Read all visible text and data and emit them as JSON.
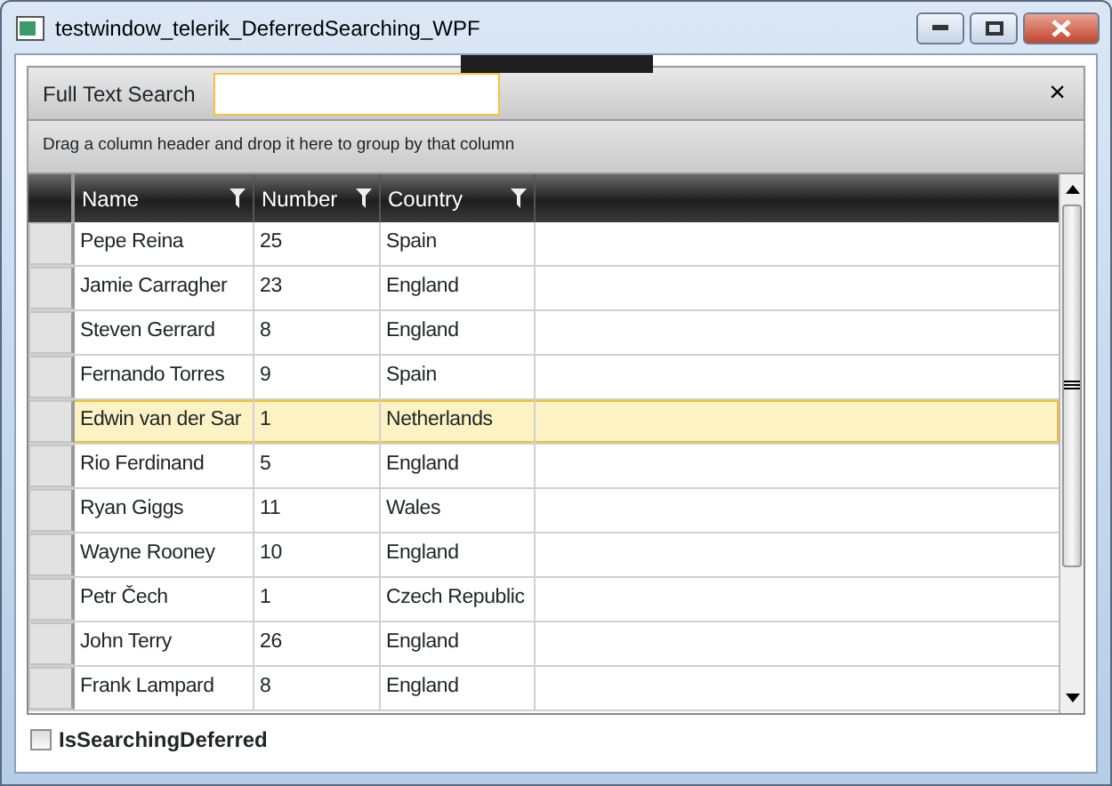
{
  "window": {
    "title": "testwindow_telerik_DeferredSearching_WPF"
  },
  "search": {
    "label": "Full Text Search",
    "clear": "×"
  },
  "group_panel": {
    "hint": "Drag a column header and drop it here to group by that column"
  },
  "table": {
    "columns": [
      "Name",
      "Number",
      "Country"
    ],
    "rows": [
      {
        "cells": [
          "Pepe Reina",
          "25",
          "Spain"
        ],
        "selected": false
      },
      {
        "cells": [
          "Jamie Carragher",
          "23",
          "England"
        ],
        "selected": false
      },
      {
        "cells": [
          "Steven Gerrard",
          "8",
          "England"
        ],
        "selected": false
      },
      {
        "cells": [
          "Fernando Torres",
          "9",
          "Spain"
        ],
        "selected": false
      },
      {
        "cells": [
          "Edwin van der Sar",
          "1",
          "Netherlands"
        ],
        "selected": true
      },
      {
        "cells": [
          "Rio Ferdinand",
          "5",
          "England"
        ],
        "selected": false
      },
      {
        "cells": [
          "Ryan Giggs",
          "11",
          "Wales"
        ],
        "selected": false
      },
      {
        "cells": [
          "Wayne Rooney",
          "10",
          "England"
        ],
        "selected": false
      },
      {
        "cells": [
          "Petr Čech",
          "1",
          "Czech Republic"
        ],
        "selected": false
      },
      {
        "cells": [
          "John Terry",
          "26",
          "England"
        ],
        "selected": false
      },
      {
        "cells": [
          "Frank Lampard",
          "8",
          "England"
        ],
        "selected": false
      }
    ]
  },
  "checkbox": {
    "label": "IsSearchingDeferred",
    "checked": false
  }
}
